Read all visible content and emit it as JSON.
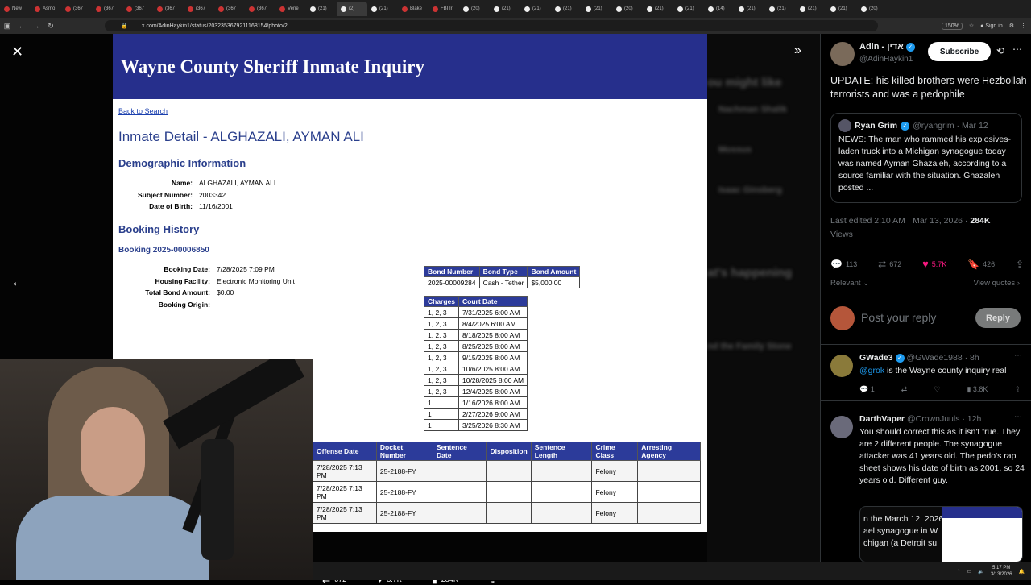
{
  "browser": {
    "tabs": [
      {
        "label": "New",
        "active": false
      },
      {
        "label": "Asmo",
        "active": false
      },
      {
        "label": "(367",
        "active": false
      },
      {
        "label": "(367",
        "active": false
      },
      {
        "label": "(367",
        "active": false
      },
      {
        "label": "(367",
        "active": false
      },
      {
        "label": "(367",
        "active": false
      },
      {
        "label": "(367",
        "active": false
      },
      {
        "label": "(367",
        "active": false
      },
      {
        "label": "Vene",
        "active": false
      },
      {
        "label": "(21)",
        "active": false
      },
      {
        "label": "(2)",
        "active": true
      },
      {
        "label": "(21)",
        "active": false
      },
      {
        "label": "Blake",
        "active": false
      },
      {
        "label": "FBI Ir",
        "active": false
      },
      {
        "label": "(20)",
        "active": false
      },
      {
        "label": "(21)",
        "active": false
      },
      {
        "label": "(21)",
        "active": false
      },
      {
        "label": "(21)",
        "active": false
      },
      {
        "label": "(21)",
        "active": false
      },
      {
        "label": "(20)",
        "active": false
      },
      {
        "label": "(21)",
        "active": false
      },
      {
        "label": "(21)",
        "active": false
      },
      {
        "label": "(14)",
        "active": false
      },
      {
        "label": "(21)",
        "active": false
      },
      {
        "label": "(21)",
        "active": false
      },
      {
        "label": "(21)",
        "active": false
      },
      {
        "label": "(21)",
        "active": false
      },
      {
        "label": "(20)",
        "active": false
      }
    ],
    "url": "x.com/AdinHaykin1/status/2032353679211168154/photo/2",
    "zoom": "150%",
    "sign_in": "Sign in"
  },
  "document": {
    "header": "Wayne County Sheriff Inmate Inquiry",
    "back_link": "Back to Search",
    "title": "Inmate Detail - ALGHAZALI, AYMAN ALI",
    "demographic_heading": "Demographic Information",
    "demographics": [
      {
        "label": "Name:",
        "value": "ALGHAZALI, AYMAN ALI"
      },
      {
        "label": "Subject Number:",
        "value": "2003342"
      },
      {
        "label": "Date of Birth:",
        "value": "11/16/2001"
      }
    ],
    "booking_heading": "Booking History",
    "booking_id": "Booking 2025-00006850",
    "booking": [
      {
        "label": "Booking Date:",
        "value": "7/28/2025 7:09 PM"
      },
      {
        "label": "Housing Facility:",
        "value": "Electronic Monitoring Unit"
      },
      {
        "label": "Total Bond Amount:",
        "value": "$0.00"
      },
      {
        "label": "Booking Origin:",
        "value": ""
      }
    ],
    "bond_table": {
      "headers": [
        "Bond Number",
        "Bond Type",
        "Bond Amount"
      ],
      "rows": [
        [
          "2025-00009284",
          "Cash - Tether",
          "$5,000.00"
        ]
      ]
    },
    "charges_table": {
      "headers": [
        "Charges",
        "Court Date"
      ],
      "rows": [
        [
          "1, 2, 3",
          "7/31/2025 6:00 AM"
        ],
        [
          "1, 2, 3",
          "8/4/2025 6:00 AM"
        ],
        [
          "1, 2, 3",
          "8/18/2025 8:00 AM"
        ],
        [
          "1, 2, 3",
          "8/25/2025 8:00 AM"
        ],
        [
          "1, 2, 3",
          "9/15/2025 8:00 AM"
        ],
        [
          "1, 2, 3",
          "10/6/2025 8:00 AM"
        ],
        [
          "1, 2, 3",
          "10/28/2025 8:00 AM"
        ],
        [
          "1, 2, 3",
          "12/4/2025 8:00 AM"
        ],
        [
          "1",
          "1/16/2026 8:00 AM"
        ],
        [
          "1",
          "2/27/2026 9:00 AM"
        ],
        [
          "1",
          "3/25/2026 8:30 AM"
        ]
      ]
    },
    "offense_table": {
      "headers": [
        "Offense Date",
        "Docket Number",
        "Sentence Date",
        "Disposition",
        "Sentence Length",
        "Crime Class",
        "Arresting Agency"
      ],
      "rows": [
        [
          "7/28/2025 7:13 PM",
          "25-2188-FY",
          "",
          "",
          "",
          "Felony",
          ""
        ],
        [
          "7/28/2025 7:13 PM",
          "25-2188-FY",
          "",
          "",
          "",
          "Felony",
          ""
        ],
        [
          "7/28/2025 7:13 PM",
          "25-2188-FY",
          "",
          "",
          "",
          "Felony",
          ""
        ]
      ]
    }
  },
  "viewer_stats": {
    "retweets": "672",
    "likes": "5.7K",
    "views": "284K"
  },
  "tweet": {
    "display_name": "Adin - אדין",
    "handle": "@AdinHaykin1",
    "subscribe": "Subscribe",
    "text": "UPDATE: his killed brothers were Hezbollah terrorists and was a pedophile",
    "quote": {
      "name": "Ryan Grim",
      "handle": "@ryangrim · Mar 12",
      "text": "NEWS: The man who rammed his explosives-laden truck into a Michigan synagogue today was named Ayman Ghazaleh, according to a source familiar with the situation. Ghazaleh posted ..."
    },
    "edited": "Last edited 2:10 AM · Mar 13, 2026 · ",
    "views_count": "284K",
    "views_label": "Views",
    "replies": "113",
    "retweets": "672",
    "likes": "5.7K",
    "bookmarks": "426",
    "relevant": "Relevant",
    "view_quotes": "View quotes",
    "reply_placeholder": "Post your reply",
    "reply_button": "Reply"
  },
  "replies": [
    {
      "name": "GWade3",
      "handle": "@GWade1988 · 8h",
      "mention": "@grok",
      "text": " is the Wayne county inquiry real",
      "stats": {
        "replies": "1",
        "views": "3.8K"
      }
    },
    {
      "name": "DarthVaper",
      "handle": "@CrownJuuls · 12h",
      "text": "You should correct this as it isn't true. They are 2 different people.  The synagogue attacker was 41 years old. The pedo's rap sheet shows his date of birth as 2001, so 24 years old. Different guy.",
      "quote_snippet": "n the March 12, 2026\nael synagogue in W\nchigan (a Detroit su"
    }
  ],
  "taskbar": {
    "time": "5:17 PM",
    "date": "3/13/2026"
  }
}
